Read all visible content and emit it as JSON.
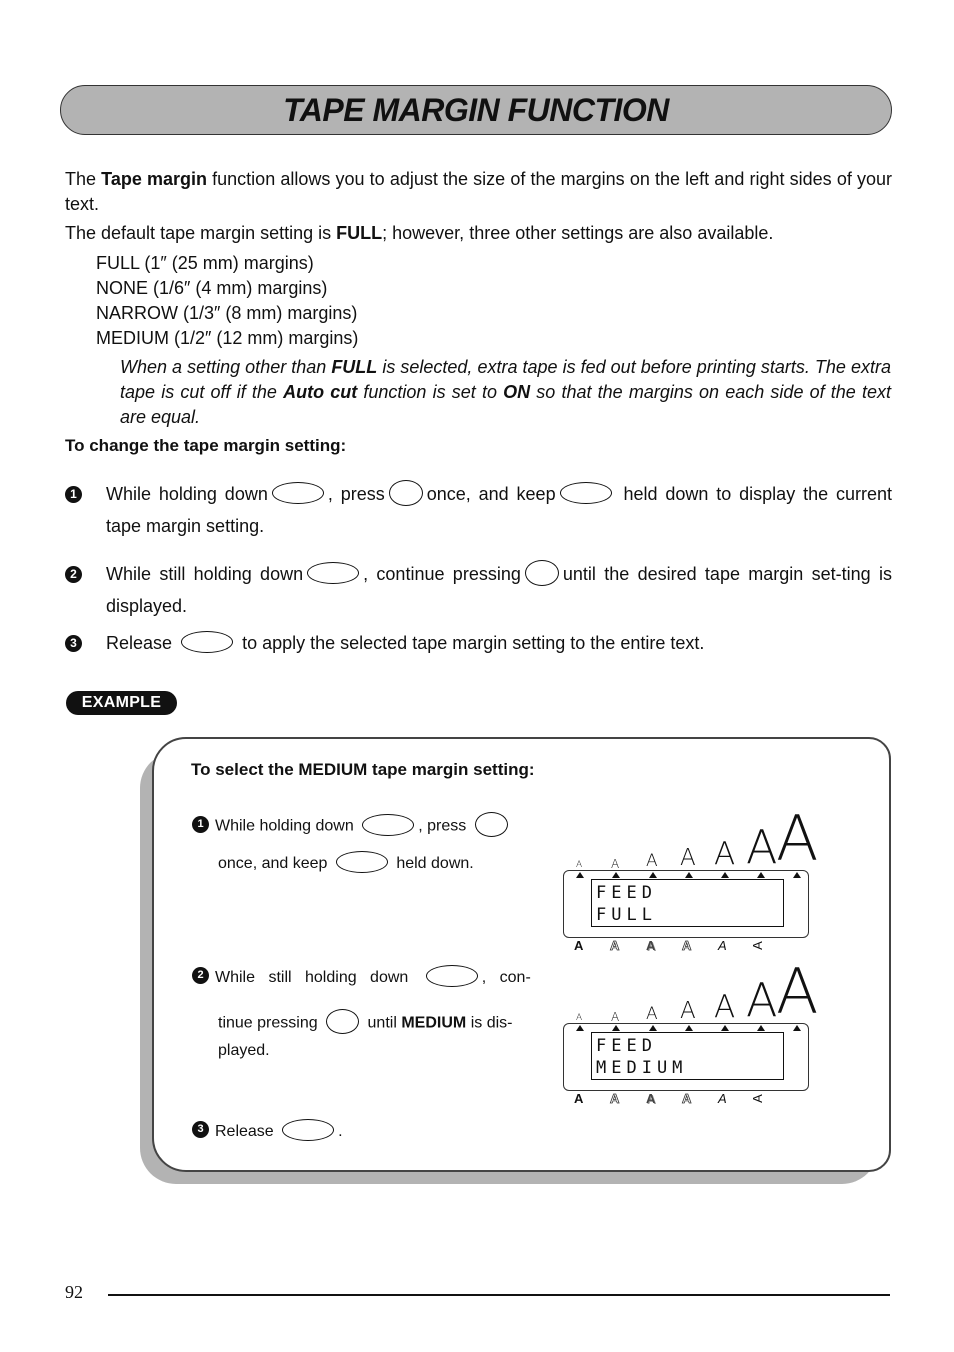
{
  "title": "TAPE MARGIN FUNCTION",
  "intro": {
    "p1_before": "The ",
    "p1_bold": "Tape margin",
    "p1_after": " function allows you to adjust the size of the margins on the left and right sides of your text.",
    "p2_before": "The default tape margin setting is ",
    "p2_bold": "FULL",
    "p2_after": "; however, three other settings are also available."
  },
  "settings": [
    "FULL (1″ (25 mm) margins)",
    "NONE (1/6″ (4 mm) margins)",
    "NARROW (1/3″ (8 mm) margins)",
    "MEDIUM (1/2″ (12 mm) margins)"
  ],
  "note": {
    "a": "When a setting other than ",
    "b": "FULL",
    "c": " is selected, extra tape is fed out before printing starts. The extra tape is cut off if the ",
    "d": "Auto cut",
    "e": " function is set to ",
    "f": "ON",
    "g": " so that the margins on each side of the text are equal."
  },
  "subheading": "To change the tape margin setting:",
  "steps": [
    {
      "num": "1",
      "a": "While holding down",
      "b": ", press",
      "c": "once, and keep",
      "d": "held down to display the current tape margin setting."
    },
    {
      "num": "2",
      "a": "While still holding down",
      "b": ", continue pressing",
      "c": "until the desired tape margin set-ting is displayed."
    },
    {
      "num": "3",
      "a": "Release",
      "b": "to apply the selected tape margin setting to the entire text."
    }
  ],
  "example": {
    "badge": "EXAMPLE",
    "title": "To select the MEDIUM tape margin setting:",
    "step1": {
      "num": "1",
      "a": "While holding down",
      "b": ", press",
      "c": "once, and keep",
      "d": "held down."
    },
    "step2": {
      "num": "2",
      "a": "While still holding down",
      "b": ", con-",
      "c": "tinue pressing",
      "d": "until",
      "e": "MEDIUM",
      "f": "is dis-",
      "g": "played."
    },
    "step3": {
      "num": "3",
      "a": "Release",
      "b": "."
    },
    "displays": [
      {
        "line1": "FEED",
        "line2": "FULL"
      },
      {
        "line1": "FEED",
        "line2": "MEDIUM"
      }
    ],
    "size_glyph": "A",
    "style_glyphs": [
      "A",
      "A",
      "A",
      "A",
      "A",
      "A"
    ]
  },
  "footer": {
    "page_number": "92"
  }
}
